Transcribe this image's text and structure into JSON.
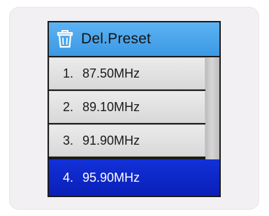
{
  "header": {
    "title": "Del.Preset",
    "icon": "trash-icon"
  },
  "presets": [
    {
      "number": "1.",
      "frequency": "87.50MHz",
      "selected": false
    },
    {
      "number": "2.",
      "frequency": "89.10MHz",
      "selected": false
    },
    {
      "number": "3.",
      "frequency": "91.90MHz",
      "selected": false
    },
    {
      "number": "4.",
      "frequency": "95.90MHz",
      "selected": true
    }
  ],
  "colors": {
    "title_bar": "#4aa6ec",
    "selected_row": "#0f28cc",
    "row": "#e3e2e3",
    "frame": "#f3f0f3"
  }
}
